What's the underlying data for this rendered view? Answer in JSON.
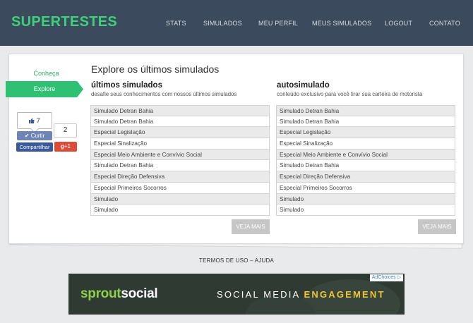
{
  "header": {
    "logo": "SUPERTESTES",
    "nav": [
      "STATS",
      "SIMULADOS",
      "MEU PERFIL",
      "MEUS SIMULADOS",
      "LOGOUT",
      "CONTATO"
    ]
  },
  "sidebar": {
    "conheca": "Conheça",
    "explore": "Explore"
  },
  "social": {
    "like_count": "7",
    "like_label": "Curtir",
    "share_count": "2",
    "share_label": "Compartilhar",
    "gplus_label": "+1",
    "gplus_g": "g"
  },
  "main": {
    "title": "Explore os últimos simulados",
    "columns": [
      {
        "title": "últimos simulados",
        "subtitle": "desafie seus conhecimentos com nossos últimos simulados",
        "items": [
          "Simulado Detran Bahia",
          "Simulado Detran Bahia",
          "Especial Legislação",
          "Especial Sinalização",
          "Especial Meio Ambiente e Convívio Social",
          "Simulado Detran Bahia",
          "Especial Direção Defensiva",
          "Especial Primeiros Socorros",
          "Simulado",
          "Simulado"
        ],
        "button": "VEJA MAIS"
      },
      {
        "title": "autosimulado",
        "subtitle": "conteúdo exclusivo para você tirar sua carteira de motorista",
        "items": [
          "Simulado Detran Bahia",
          "Simulado Detran Bahia",
          "Especial Legislação",
          "Especial Sinalização",
          "Especial Meio Ambiente e Convívio Social",
          "Simulado Detran Bahia",
          "Especial Direção Defensiva",
          "Especial Primeiros Socorros",
          "Simulado",
          "Simulado"
        ],
        "button": "VEJA MAIS"
      }
    ]
  },
  "footer": {
    "termos": "TERMOS DE USO",
    "sep": "–",
    "ajuda": "AJUDA"
  },
  "ad": {
    "adchoices": "AdChoices",
    "brand_a": "sprout",
    "brand_b": "social",
    "tagline_a": "SOCIAL MEDIA ",
    "tagline_b": "ENGAGEMENT"
  },
  "colors": {
    "header_bg": "#3b4a5d",
    "brand_green": "#3dd17a",
    "explore_green": "#2fc073",
    "facebook_blue": "#3b5998",
    "gplus_red": "#dd4b39"
  }
}
